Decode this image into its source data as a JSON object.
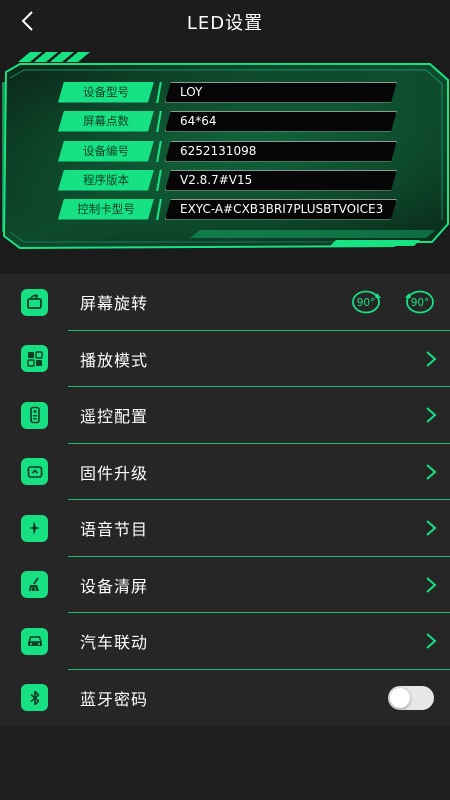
{
  "header": {
    "title": "LED设置"
  },
  "device_info": [
    {
      "label": "设备型号",
      "value": "LOY"
    },
    {
      "label": "屏幕点数",
      "value": "64*64"
    },
    {
      "label": "设备编号",
      "value": "6252131098"
    },
    {
      "label": "程序版本",
      "value": "V2.8.7#V15"
    },
    {
      "label": "控制卡型号",
      "value": "EXYC-A#CXB3BRI7PLUSBTVOICE3"
    }
  ],
  "menu": [
    {
      "label": "屏幕旋转",
      "icon": "rotate-screen-icon",
      "control": "rotate",
      "rotate_left": "90°",
      "rotate_right": "90°"
    },
    {
      "label": "播放模式",
      "icon": "play-mode-icon",
      "control": "chevron"
    },
    {
      "label": "遥控配置",
      "icon": "remote-control-icon",
      "control": "chevron"
    },
    {
      "label": "固件升级",
      "icon": "firmware-upgrade-icon",
      "control": "chevron"
    },
    {
      "label": "语音节目",
      "icon": "voice-program-icon",
      "control": "chevron"
    },
    {
      "label": "设备清屏",
      "icon": "clear-screen-icon",
      "control": "chevron"
    },
    {
      "label": "汽车联动",
      "icon": "car-link-icon",
      "control": "chevron"
    },
    {
      "label": "蓝牙密码",
      "icon": "bluetooth-icon",
      "control": "toggle",
      "toggle_on": false
    }
  ],
  "colors": {
    "accent": "#17e083",
    "background": "#1f1f1f",
    "row_background": "#262626"
  }
}
